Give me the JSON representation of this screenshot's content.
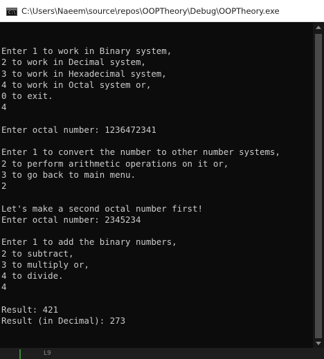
{
  "window": {
    "title": "C:\\Users\\Naeem\\source\\repos\\OOPTheory\\Debug\\OOPTheory.exe",
    "icon": "console-app-icon"
  },
  "console": {
    "lines": [
      "Enter 1 to work in Binary system,",
      "2 to work in Decimal system,",
      "3 to work in Hexadecimal system,",
      "4 to work in Octal system or,",
      "0 to exit.",
      "4",
      "",
      "Enter octal number: 1236472341",
      "",
      "Enter 1 to convert the number to other number systems,",
      "2 to perform arithmetic operations on it or,",
      "3 to go back to main menu.",
      "2",
      "",
      "Let's make a second octal number first!",
      "Enter octal number: 2345234",
      "",
      "Enter 1 to add the binary numbers,",
      "2 to subtract,",
      "3 to multiply or,",
      "4 to divide.",
      "4",
      "",
      "Result: 421",
      "Result (in Decimal): 273"
    ]
  },
  "statusbar": {
    "text": "L9"
  },
  "colors": {
    "background": "#0c0c0c",
    "text": "#cccccc",
    "titlebar": "#ffffff"
  }
}
